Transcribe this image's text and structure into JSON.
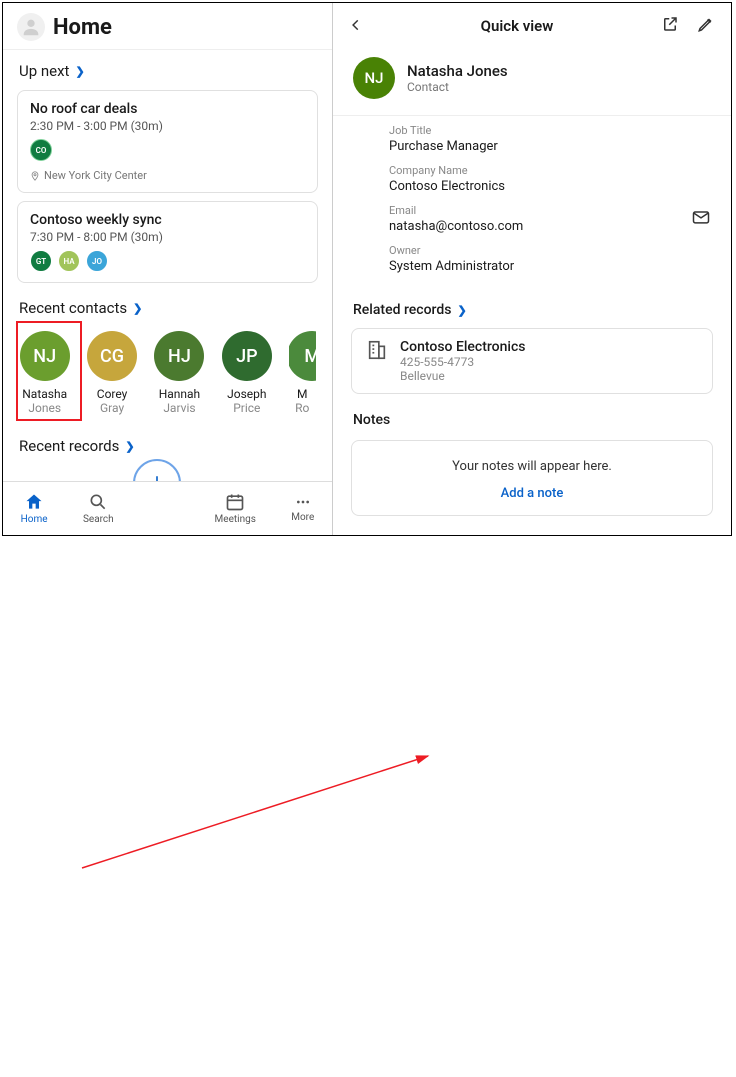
{
  "header": {
    "title": "Home"
  },
  "up_next": {
    "label": "Up next",
    "events": [
      {
        "title": "No roof car deals",
        "time": "2:30 PM - 3:00 PM (30m)",
        "location": "New York City Center",
        "attendees": [
          {
            "initials": "CO",
            "color": "#107c41"
          }
        ]
      },
      {
        "title": "Contoso weekly sync",
        "time": "7:30 PM - 8:00 PM (30m)",
        "attendees": [
          {
            "initials": "GT",
            "color": "#107c41"
          },
          {
            "initials": "HA",
            "color": "#a1c45a"
          },
          {
            "initials": "JO",
            "color": "#3ba5d9"
          }
        ]
      }
    ]
  },
  "recent_contacts": {
    "label": "Recent contacts",
    "items": [
      {
        "initials": "NJ",
        "first": "Natasha",
        "last": "Jones",
        "color": "#6b9e2e"
      },
      {
        "initials": "CG",
        "first": "Corey",
        "last": "Gray",
        "color": "#c6a63c"
      },
      {
        "initials": "HJ",
        "first": "Hannah",
        "last": "Jarvis",
        "color": "#4b7a2f"
      },
      {
        "initials": "JP",
        "first": "Joseph",
        "last": "Price",
        "color": "#2f6b2f"
      },
      {
        "initials": "M",
        "first": "M",
        "last": "Ro",
        "color": "#4b8a3c"
      }
    ]
  },
  "recent_records": {
    "label": "Recent records"
  },
  "nav": {
    "home": "Home",
    "search": "Search",
    "meetings": "Meetings",
    "more": "More"
  },
  "quick_view": {
    "title": "Quick view",
    "name": "Natasha Jones",
    "type": "Contact",
    "fields": {
      "job_title_label": "Job Title",
      "job_title": "Purchase Manager",
      "company_label": "Company Name",
      "company": "Contoso Electronics",
      "email_label": "Email",
      "email": "natasha@contoso.com",
      "owner_label": "Owner",
      "owner": "System Administrator"
    },
    "related": {
      "label": "Related records",
      "record": {
        "title": "Contoso Electronics",
        "phone": "425-555-4773",
        "city": "Bellevue"
      }
    },
    "notes": {
      "label": "Notes",
      "placeholder": "Your notes will appear here.",
      "action": "Add a note"
    }
  }
}
